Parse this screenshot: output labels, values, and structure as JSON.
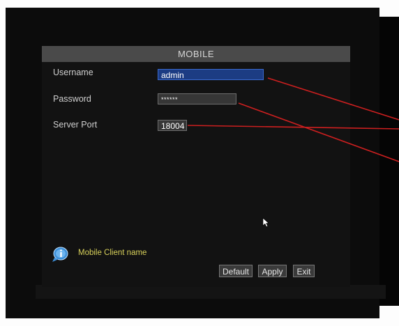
{
  "dialog": {
    "title": "MOBILE",
    "fields": [
      {
        "label": "Username",
        "value": "admin"
      },
      {
        "label": "Password",
        "value": "******"
      },
      {
        "label": "Server Port",
        "value": "18004"
      }
    ],
    "info_text": "Mobile Client name",
    "buttons": {
      "default": "Default",
      "apply": "Apply",
      "exit": "Exit"
    }
  },
  "icons": {
    "info": "info-icon",
    "cursor": "mouse-pointer-icon"
  },
  "colors": {
    "titlebar": "#4a4a4a",
    "active_field": "#1c3c83",
    "info_text": "#d7d05a",
    "annotation_lines": "#cc1f1f"
  }
}
